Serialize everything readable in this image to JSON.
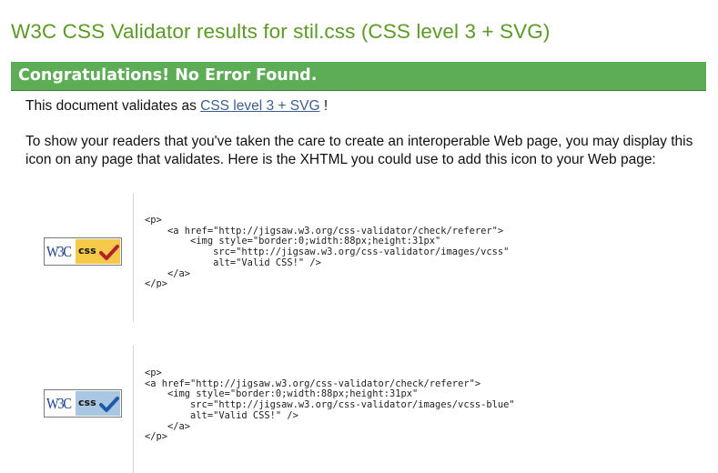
{
  "page": {
    "title": "W3C CSS Validator results for stil.css (CSS level 3 + SVG)"
  },
  "banner": {
    "text": "Congratulations! No Error Found.",
    "color": "#5cad55"
  },
  "validates": {
    "prefix": "This document validates as ",
    "link": "CSS level 3 + SVG",
    "suffix": " !"
  },
  "instructions": "To show your readers that you've taken the care to create an interoperable Web page, you may display this icon on any page that validates. Here is the XHTML you could use to add this icon to your Web page:",
  "badges": [
    {
      "logo": "W3C",
      "label": "css",
      "panel_color": "#f5c94a",
      "check_color": "#b0232a",
      "icon": "valid-css-badge-icon",
      "code": "<p>\n    <a href=\"http://jigsaw.w3.org/css-validator/check/referer\">\n        <img style=\"border:0;width:88px;height:31px\"\n            src=\"http://jigsaw.w3.org/css-validator/images/vcss\"\n            alt=\"Valid CSS!\" />\n    </a>\n</p>"
    },
    {
      "logo": "W3C",
      "label": "css",
      "panel_color": "#a9c6e2",
      "check_color": "#1e5aa8",
      "icon": "valid-css-blue-badge-icon",
      "code": "<p>\n<a href=\"http://jigsaw.w3.org/css-validator/check/referer\">\n    <img style=\"border:0;width:88px;height:31px\"\n        src=\"http://jigsaw.w3.org/css-validator/images/vcss-blue\"\n        alt=\"Valid CSS!\" />\n    </a>\n</p>"
    }
  ]
}
